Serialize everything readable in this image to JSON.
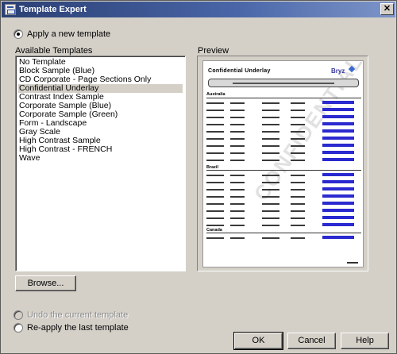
{
  "window": {
    "title": "Template Expert",
    "close_glyph": "✕"
  },
  "options": {
    "apply_new": "Apply a new template",
    "undo_current": "Undo the current template",
    "reapply_last": "Re-apply the last template"
  },
  "templates": {
    "label": "Available Templates",
    "items": [
      "No Template",
      "Block Sample (Blue)",
      "CD Corporate - Page Sections Only",
      "Confidential Underlay",
      "Contrast Index Sample",
      "Corporate Sample (Blue)",
      "Corporate Sample (Green)",
      "Form - Landscape",
      "Gray Scale",
      "High Contrast Sample",
      "High Contrast - FRENCH",
      "Wave"
    ],
    "selected": "Confidential Underlay"
  },
  "preview": {
    "label": "Preview",
    "doc_title": "Confidential Underlay",
    "sections": [
      "Australia",
      "Brazil",
      "Canada"
    ],
    "watermark": "CONFIDENTIAL",
    "accent_color": "#2a2ad0"
  },
  "buttons": {
    "browse": "Browse...",
    "ok": "OK",
    "cancel": "Cancel",
    "help": "Help"
  }
}
